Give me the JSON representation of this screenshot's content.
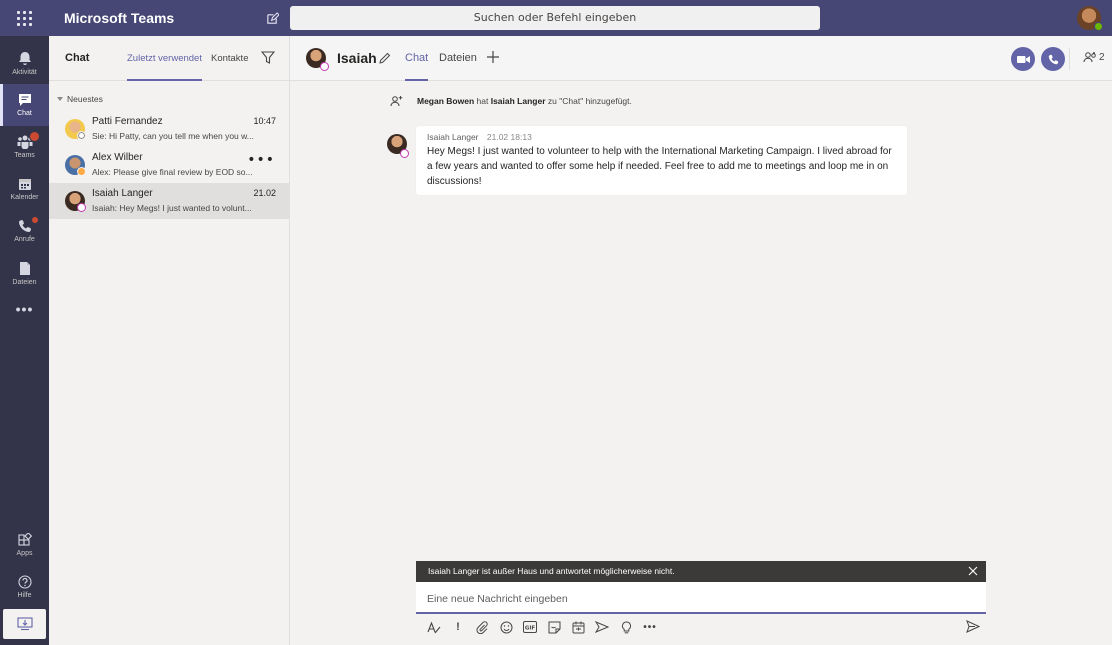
{
  "app": {
    "title": "Microsoft Teams"
  },
  "search": {
    "placeholder": "Suchen oder Befehl eingeben"
  },
  "colors": {
    "brand": "#6264a7",
    "topbar": "#464775",
    "rail": "#33344a",
    "presence_oof": "#c239b3",
    "presence_available": "#6bb700",
    "presence_away": "#ffaa44"
  },
  "rail": {
    "items": [
      {
        "label": "Aktivität",
        "icon": "bell-icon"
      },
      {
        "label": "Chat",
        "icon": "chat-icon"
      },
      {
        "label": "Teams",
        "icon": "teams-icon"
      },
      {
        "label": "Kalender",
        "icon": "calendar-icon"
      },
      {
        "label": "Anrufe",
        "icon": "phone-icon"
      },
      {
        "label": "Dateien",
        "icon": "file-icon"
      }
    ],
    "apps_label": "Apps",
    "help_label": "Hilfe"
  },
  "chat_list": {
    "title": "Chat",
    "tabs": [
      "Zuletzt verwendet",
      "Kontakte"
    ],
    "section": "Neuestes",
    "items": [
      {
        "name": "Patti Fernandez",
        "time": "10:47",
        "preview": "Sie: Hi Patty, can you tell me when you w...",
        "presence": "offline"
      },
      {
        "name": "Alex Wilber",
        "time": "",
        "preview": "Alex: Please give final review by EOD so...",
        "presence": "away"
      },
      {
        "name": "Isaiah Langer",
        "time": "21.02",
        "preview": "Isaiah: Hey Megs! I just wanted to volunt...",
        "presence": "oof"
      }
    ]
  },
  "conversation": {
    "name": "Isaiah",
    "tabs": [
      "Chat",
      "Dateien"
    ],
    "participants_count": "2",
    "system_message": {
      "actor": "Megan Bowen",
      "middle": " hat ",
      "target": "Isaiah Langer",
      "rest": " zu \"Chat\" hinzugefügt."
    },
    "message": {
      "author": "Isaiah Langer",
      "timestamp": "21.02 18:13",
      "text": "Hey Megs! I just wanted to volunteer to help with the International Marketing Campaign. I lived abroad for a few years and wanted to offer some help if needed. Feel free to add me to meetings and loop me in on discussions!"
    },
    "oof_notice": "Isaiah Langer ist außer Haus und antwortet möglicherweise nicht.",
    "compose_placeholder": "Eine neue Nachricht eingeben"
  }
}
